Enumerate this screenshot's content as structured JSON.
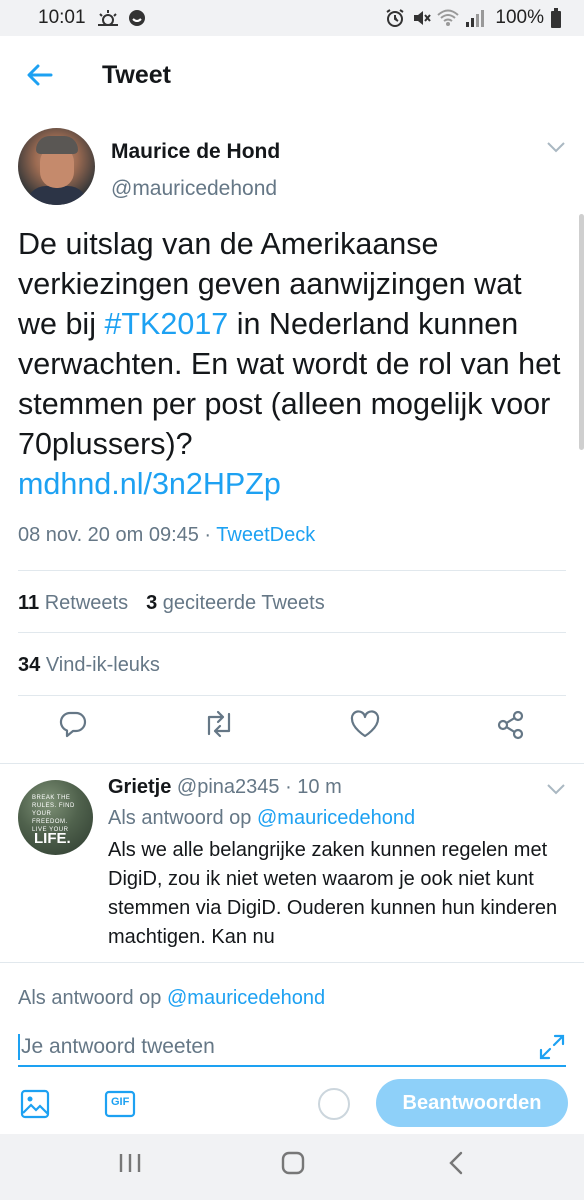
{
  "status_bar": {
    "time": "10:01",
    "battery": "100%",
    "left_icons": [
      "weather-icon",
      "notification-icon"
    ],
    "right_icons": [
      "alarm-icon",
      "mute-icon",
      "wifi-icon",
      "signal-icon",
      "battery-icon"
    ]
  },
  "app_bar": {
    "title": "Tweet"
  },
  "tweet": {
    "author_name": "Maurice de Hond",
    "author_handle": "@mauricedehond",
    "text_part1": "De uitslag van de Amerikaanse verkiezingen geven aanwijzingen wat we bij ",
    "hashtag": "#TK2017",
    "text_part2": " in Nederland kunnen verwachten. En wat wordt de rol van het stemmen per post (alleen mogelijk voor 70plussers)?",
    "link": "mdhnd.nl/3n2HPZp",
    "timestamp": "08 nov. 20 om 09:45 · ",
    "source": "TweetDeck"
  },
  "stats": {
    "retweets_count": "11",
    "retweets_label": "Retweets",
    "quotes_count": "3",
    "quotes_label": "geciteerde Tweets",
    "likes_count": "34",
    "likes_label": "Vind-ik-leuks"
  },
  "reply": {
    "name": "Grietje",
    "handle_time": "@pina2345 · 10 m",
    "replying_to_label": "Als antwoord op ",
    "replying_to_handle": "@mauricedehond",
    "text": "Als we alle belangrijke zaken kunnen regelen met DigiD, zou ik niet weten waarom je ook niet kunt stemmen via DigiD. Ouderen kunnen hun kinderen machtigen. Kan nu",
    "avatar_line1": "BREAK THE RULES. FIND YOUR FREEDOM. LIVE YOUR",
    "avatar_line2": "LIFE."
  },
  "composer": {
    "replying_to_label": "Als antwoord op ",
    "replying_to_handle": "@mauricedehond",
    "placeholder": "Je antwoord tweeten",
    "gif_label": "GIF",
    "submit_label": "Beantwoorden"
  },
  "colors": {
    "accent": "#1da1f2",
    "muted": "#657786",
    "button_disabled": "#8ed0f9"
  }
}
